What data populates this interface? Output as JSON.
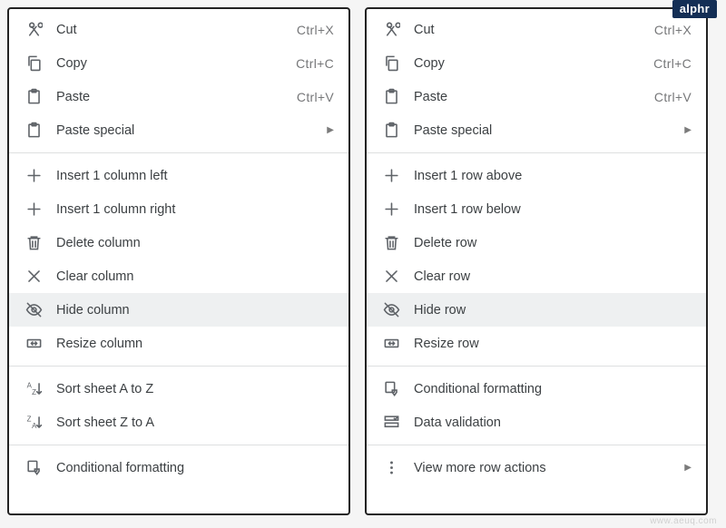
{
  "badge": "alphr",
  "watermark": "www.aeuq.com",
  "leftMenu": {
    "cut": {
      "label": "Cut",
      "shortcut": "Ctrl+X"
    },
    "copy": {
      "label": "Copy",
      "shortcut": "Ctrl+C"
    },
    "paste": {
      "label": "Paste",
      "shortcut": "Ctrl+V"
    },
    "pasteSpec": {
      "label": "Paste special"
    },
    "insLeft": {
      "label": "Insert 1 column left"
    },
    "insRight": {
      "label": "Insert 1 column right"
    },
    "deleteCol": {
      "label": "Delete column"
    },
    "clearCol": {
      "label": "Clear column"
    },
    "hideCol": {
      "label": "Hide column"
    },
    "resizeCol": {
      "label": "Resize column"
    },
    "sortAZ": {
      "label": "Sort sheet A to Z"
    },
    "sortZA": {
      "label": "Sort sheet Z to A"
    },
    "condFmt": {
      "label": "Conditional formatting"
    }
  },
  "rightMenu": {
    "cut": {
      "label": "Cut",
      "shortcut": "Ctrl+X"
    },
    "copy": {
      "label": "Copy",
      "shortcut": "Ctrl+C"
    },
    "paste": {
      "label": "Paste",
      "shortcut": "Ctrl+V"
    },
    "pasteSpec": {
      "label": "Paste special"
    },
    "insAbove": {
      "label": "Insert 1 row above"
    },
    "insBelow": {
      "label": "Insert 1 row below"
    },
    "deleteRow": {
      "label": "Delete row"
    },
    "clearRow": {
      "label": "Clear row"
    },
    "hideRow": {
      "label": "Hide row"
    },
    "resizeRow": {
      "label": "Resize row"
    },
    "condFmt": {
      "label": "Conditional formatting"
    },
    "dataVal": {
      "label": "Data validation"
    },
    "moreActions": {
      "label": "View more row actions"
    }
  }
}
